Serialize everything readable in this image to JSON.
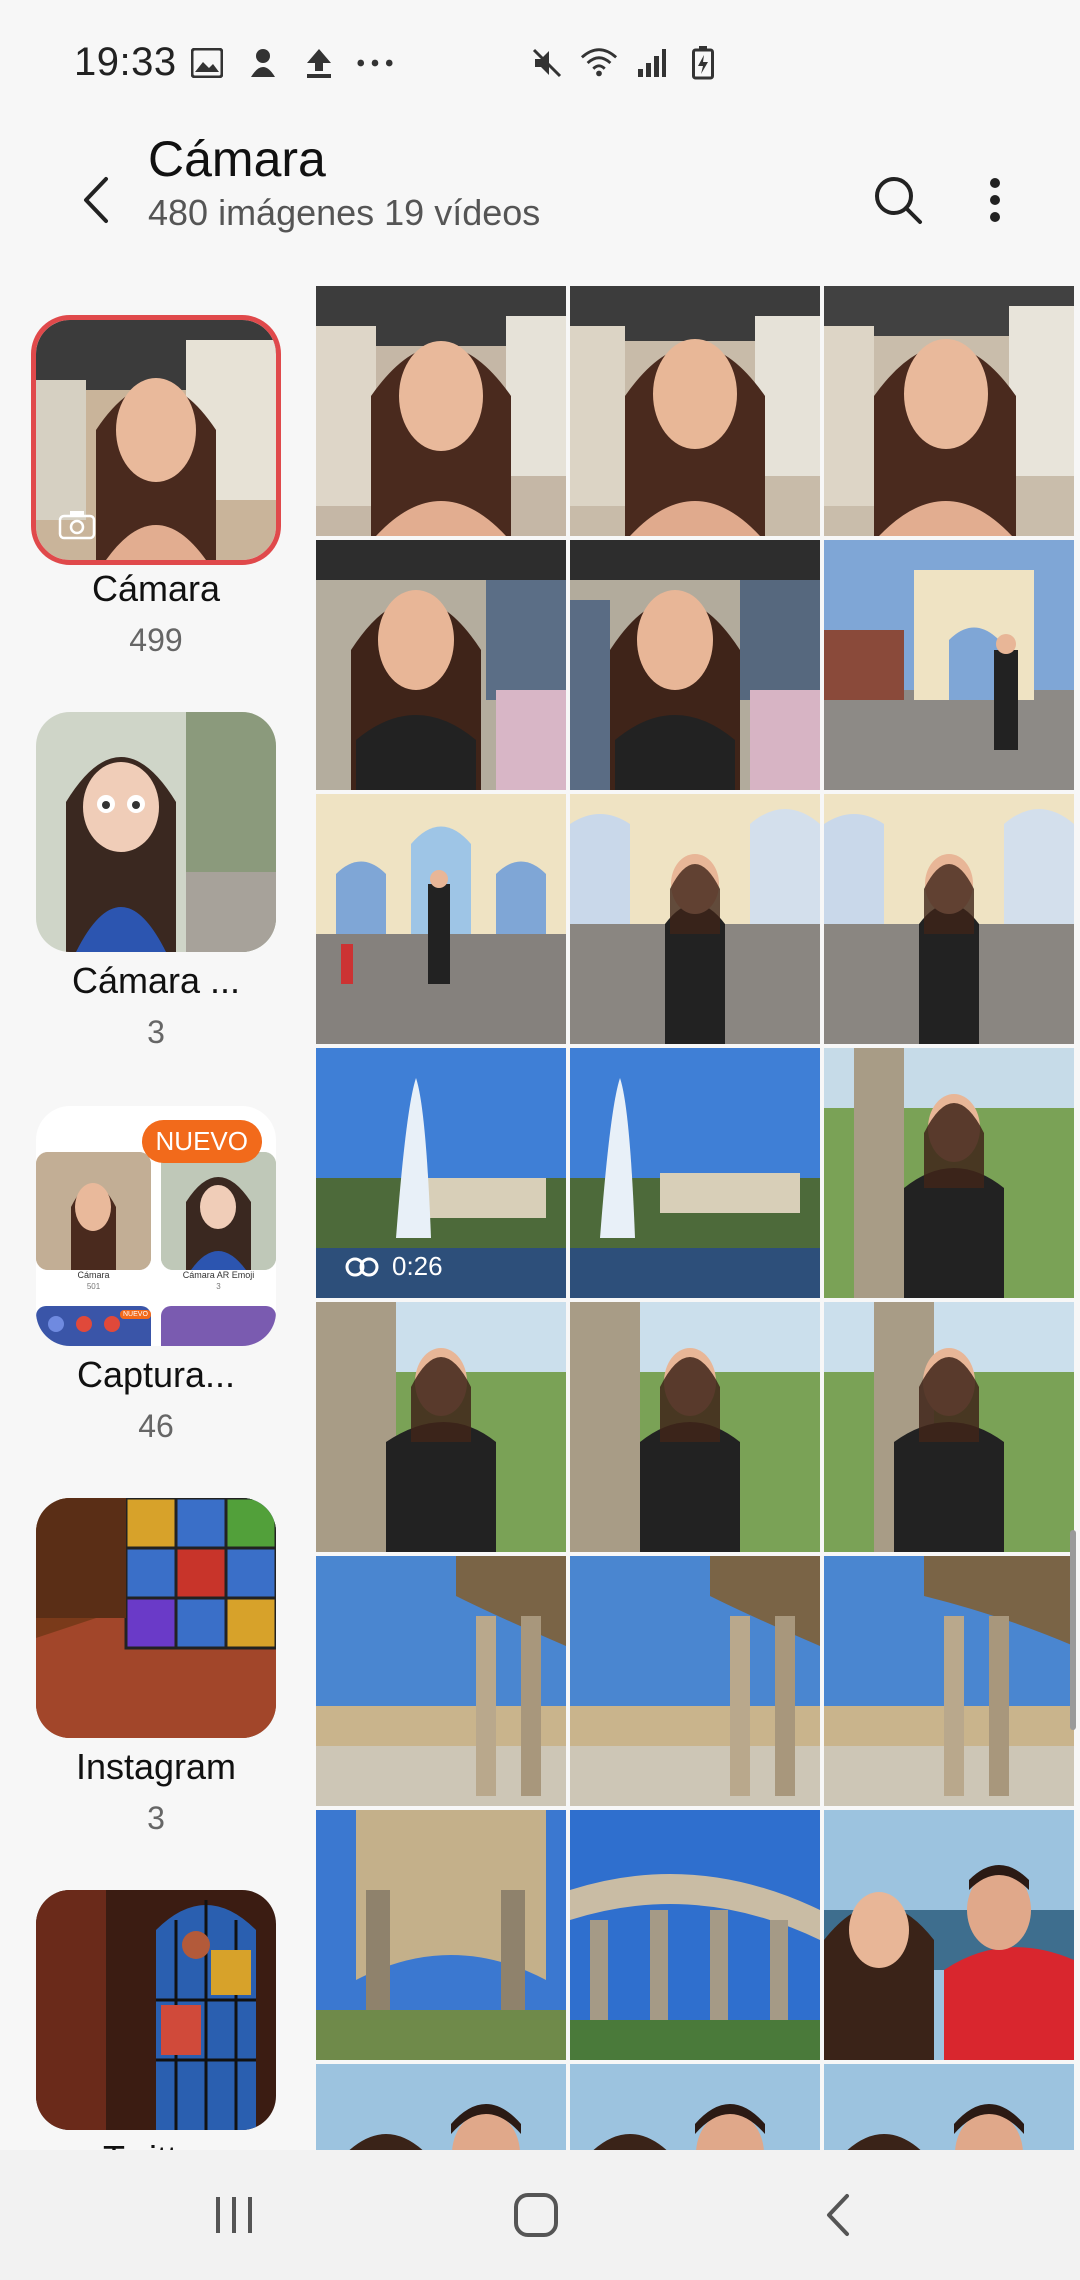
{
  "status_bar": {
    "time": "19:33",
    "left_icons": [
      "gallery-icon",
      "notification-icon",
      "upload-icon",
      "more-dots-icon"
    ],
    "right_icons": [
      "mute-icon",
      "wifi-icon",
      "signal-icon",
      "battery-icon"
    ]
  },
  "header": {
    "title": "Cámara",
    "subtitle": "480 imágenes 19 vídeos"
  },
  "albums": [
    {
      "name": "Cámara",
      "count": "499",
      "selected": true
    },
    {
      "name": "Cámara ...",
      "count": "3"
    },
    {
      "name": "Captura...",
      "count": "46",
      "badge": "NUEVO",
      "preview": {
        "left_label": "Cámara",
        "left_count": "501",
        "right_label": "Cámara AR Emoji",
        "right_count": "3",
        "mini_badge": "NUEVO"
      }
    },
    {
      "name": "Instagram",
      "count": "3"
    },
    {
      "name": "Twitter",
      "count": ""
    }
  ],
  "video": {
    "duration": "0:26"
  },
  "colors": {
    "accent_selected": "#e0494b",
    "badge_new": "#f26a1b",
    "background": "#f7f7f7"
  }
}
